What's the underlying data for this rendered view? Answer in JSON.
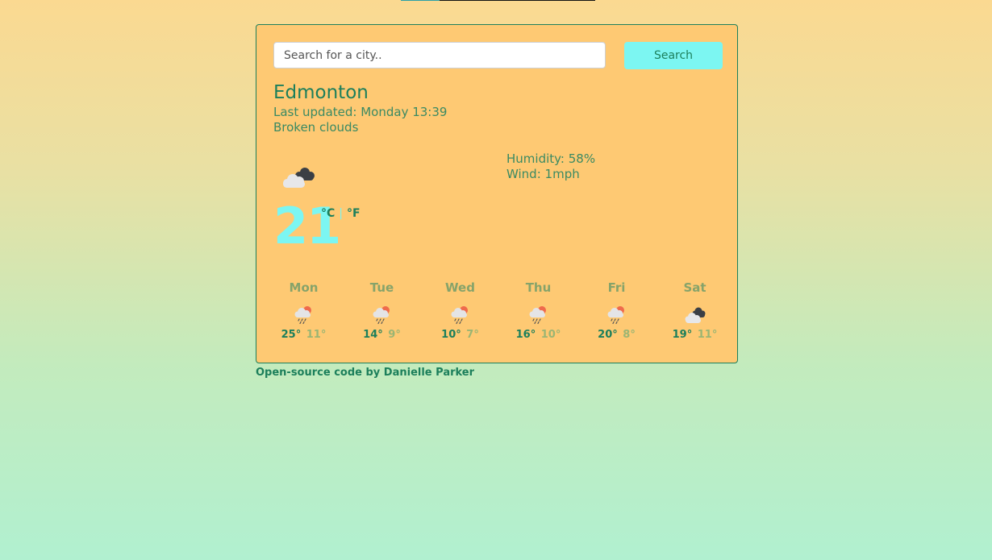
{
  "search": {
    "placeholder": "Search for a city..",
    "button_label": "Search"
  },
  "current": {
    "city": "Edmonton",
    "updated_label": "Last updated:",
    "updated_value": "Monday 13:39",
    "description": "Broken clouds",
    "icon": "broken-clouds-icon",
    "temperature": "21",
    "unit_celsius": "°C",
    "unit_separator": "|",
    "unit_fahrenheit": "°F",
    "humidity_label": "Humidity:",
    "humidity_value": "58%",
    "wind_label": "Wind:",
    "wind_value": "1mph"
  },
  "forecast": [
    {
      "day": "Mon",
      "icon": "rain-icon",
      "max": "25°",
      "min": "11°"
    },
    {
      "day": "Tue",
      "icon": "rain-icon",
      "max": "14°",
      "min": "9°"
    },
    {
      "day": "Wed",
      "icon": "rain-icon",
      "max": "10°",
      "min": "7°"
    },
    {
      "day": "Thu",
      "icon": "rain-icon",
      "max": "16°",
      "min": "10°"
    },
    {
      "day": "Fri",
      "icon": "rain-icon",
      "max": "20°",
      "min": "8°"
    },
    {
      "day": "Sat",
      "icon": "broken-clouds-icon",
      "max": "19°",
      "min": "11°"
    }
  ],
  "footer": {
    "link_text": "Open-source code",
    "by_text": "by Danielle Parker"
  },
  "colors": {
    "accent": "#7cf6f2",
    "text_primary": "#1c7f5b",
    "card_background": "#fec973"
  }
}
